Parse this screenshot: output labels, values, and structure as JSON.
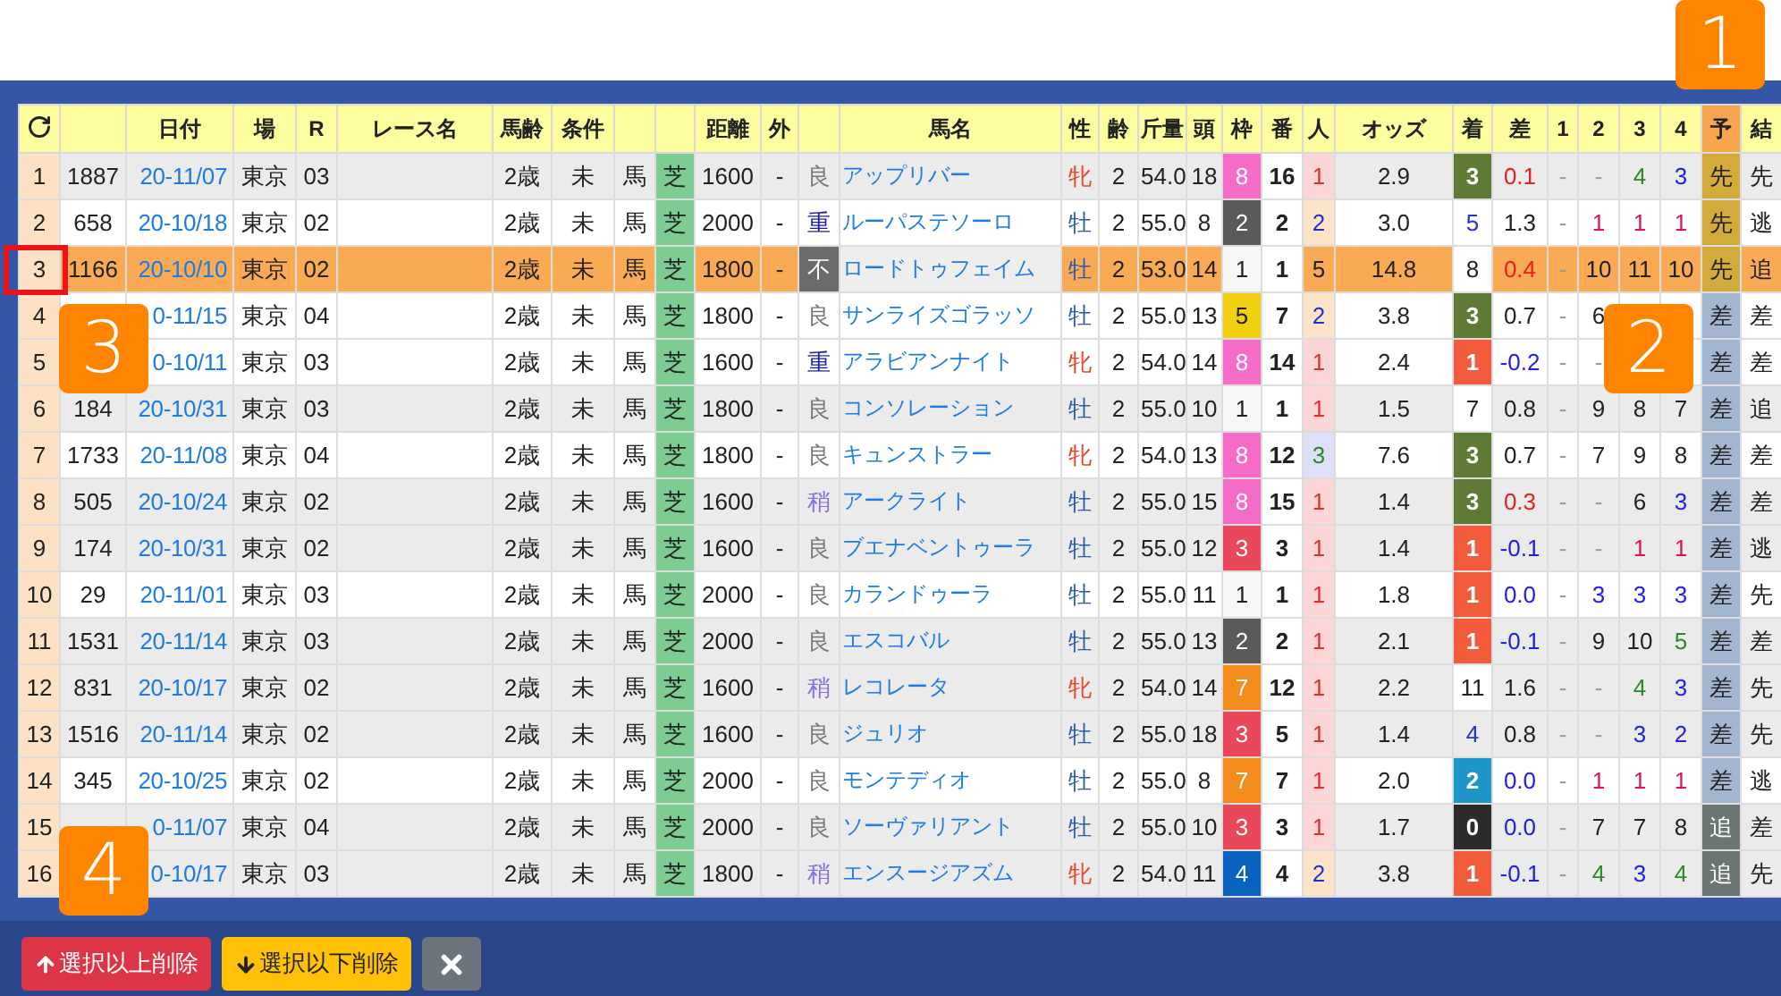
{
  "table": {
    "columns": [
      {
        "kind": "refresh"
      },
      {},
      {
        "label": "日付"
      },
      {
        "label": "場"
      },
      {
        "label": "R"
      },
      {
        "label": "レース名"
      },
      {
        "label": "馬齢"
      },
      {
        "label": "条件"
      },
      {},
      {},
      {
        "label": "距離"
      },
      {
        "label": "外"
      },
      {},
      {
        "label": "馬名"
      },
      {
        "label": "性"
      },
      {
        "label": "齢"
      },
      {
        "label": "斤量"
      },
      {
        "label": "頭"
      },
      {
        "label": "枠"
      },
      {
        "label": "番"
      },
      {
        "label": "人"
      },
      {
        "label": "オッズ"
      },
      {
        "label": "着"
      },
      {
        "label": "差"
      },
      {
        "label": "1"
      },
      {
        "label": "2"
      },
      {
        "label": "3"
      },
      {
        "label": "4"
      },
      {
        "label": "予",
        "color": "#f7a54f"
      },
      {
        "label": "結"
      }
    ],
    "rows": [
      {
        "selected": false,
        "shaded": true,
        "cells": [
          "1",
          "1887",
          "20-11/07",
          "東京",
          "03",
          null,
          "2歳",
          "未",
          "馬",
          "芝",
          "1600",
          "-",
          {
            "text": "良",
            "color": "#777777"
          },
          "アップリバー",
          {
            "text": "牝",
            "color": "#e8452c"
          },
          "2",
          "54.0",
          "18",
          {
            "kind": "fill",
            "text": "8",
            "color": "#f56cc8"
          },
          "16",
          {
            "kind": "fill",
            "text": "1",
            "color": "#fcd6d6"
          },
          "2.9",
          {
            "kind": "fill",
            "text": "3",
            "color": "#5e7b36"
          },
          {
            "text": "0.1",
            "color": "#e62020"
          },
          {
            "text": "-",
            "color": "#999999"
          },
          {
            "text": "-",
            "color": "#999999"
          },
          {
            "text": "4",
            "color": "#2a8a2a"
          },
          {
            "text": "3",
            "color": "#2222dd"
          },
          {
            "kind": "fill",
            "text": "先",
            "color": "#d3aa3c"
          },
          "先"
        ]
      },
      {
        "selected": false,
        "shaded": false,
        "cells": [
          "2",
          "658",
          "20-10/18",
          "東京",
          "02",
          null,
          "2歳",
          "未",
          "馬",
          "芝",
          "2000",
          "-",
          {
            "text": "重",
            "color": "#1a1aa0"
          },
          "ルーパステソーロ",
          {
            "text": "牡",
            "color": "#2a5caa"
          },
          "2",
          "55.0",
          "8",
          {
            "kind": "fill",
            "text": "2",
            "color": "#5a5a5a"
          },
          "2",
          {
            "kind": "fill",
            "text": "2",
            "color": "#fde4c8"
          },
          "3.0",
          {
            "text": "5",
            "color": "#2233cc"
          },
          "1.3",
          {
            "text": "-",
            "color": "#999999"
          },
          {
            "text": "1",
            "color": "#e0105a"
          },
          {
            "text": "1",
            "color": "#e0105a"
          },
          {
            "text": "1",
            "color": "#e0105a"
          },
          {
            "kind": "fill",
            "text": "先",
            "color": "#d3aa3c"
          },
          "逃"
        ]
      },
      {
        "selected": true,
        "cells": [
          "3",
          "1166",
          "20-10/10",
          "東京",
          "02",
          null,
          "2歳",
          "未",
          "馬",
          "芝",
          "1800",
          "-",
          {
            "kind": "fill",
            "text": "不",
            "color": "#6b6b6b"
          },
          {
            "kind": "fill",
            "text": "ロードトゥフェイム",
            "color": "#eeeeee"
          },
          {
            "text": "牡",
            "color": "#2a5caa"
          },
          "2",
          "53.0",
          "14",
          {
            "kind": "fill",
            "text": "1",
            "color": "#f7f7f7"
          },
          "1",
          "5",
          "14.8",
          {
            "kind": "fill",
            "text": "8",
            "color": "#ffffff"
          },
          {
            "text": "0.4",
            "color": "#e62020"
          },
          {
            "text": "-",
            "color": "#999999"
          },
          "10",
          "11",
          "10",
          {
            "kind": "fill",
            "text": "先",
            "color": "#d3aa3c"
          },
          "追"
        ]
      },
      {
        "selected": false,
        "shaded": false,
        "cells": [
          "4",
          null,
          "0-11/15",
          "東京",
          "04",
          null,
          "2歳",
          "未",
          "馬",
          "芝",
          "1800",
          "-",
          {
            "text": "良",
            "color": "#777777"
          },
          "サンライズゴラッソ",
          {
            "text": "牡",
            "color": "#2a5caa"
          },
          "2",
          "55.0",
          "13",
          {
            "kind": "fill",
            "text": "5",
            "color": "#f0d010"
          },
          "7",
          {
            "kind": "fill",
            "text": "2",
            "color": "#fde4c8"
          },
          "3.8",
          {
            "kind": "fill",
            "text": "3",
            "color": "#5e7b36"
          },
          "0.7",
          {
            "text": "-",
            "color": "#999999"
          },
          "6",
          null,
          null,
          {
            "kind": "fill",
            "text": "差",
            "color": "#a2b7cf"
          },
          "差"
        ]
      },
      {
        "selected": false,
        "shaded": false,
        "cells": [
          "5",
          null,
          "0-10/11",
          "東京",
          "03",
          null,
          "2歳",
          "未",
          "馬",
          "芝",
          "1600",
          "-",
          {
            "text": "重",
            "color": "#1a1aa0"
          },
          "アラビアンナイト",
          {
            "text": "牝",
            "color": "#e8452c"
          },
          "2",
          "54.0",
          "14",
          {
            "kind": "fill",
            "text": "8",
            "color": "#f56cc8"
          },
          "14",
          {
            "kind": "fill",
            "text": "1",
            "color": "#fcd6d6"
          },
          "2.4",
          {
            "kind": "fill",
            "text": "1",
            "color": "#f25c3c"
          },
          {
            "text": "-0.2",
            "color": "#2020e0"
          },
          {
            "text": "-",
            "color": "#999999"
          },
          {
            "text": "-",
            "color": "#999999"
          },
          null,
          null,
          {
            "kind": "fill",
            "text": "差",
            "color": "#a2b7cf"
          },
          "差"
        ]
      },
      {
        "selected": false,
        "shaded": true,
        "cells": [
          "6",
          "184",
          "20-10/31",
          "東京",
          "03",
          null,
          "2歳",
          "未",
          "馬",
          "芝",
          "1800",
          "-",
          {
            "text": "良",
            "color": "#777777"
          },
          "コンソレーション",
          {
            "text": "牡",
            "color": "#2a5caa"
          },
          "2",
          "55.0",
          "10",
          {
            "kind": "fill",
            "text": "1",
            "color": "#f7f7f7"
          },
          "1",
          {
            "kind": "fill",
            "text": "1",
            "color": "#fcd6d6"
          },
          "1.5",
          {
            "kind": "fill",
            "text": "7",
            "color": "#ffffff"
          },
          "0.8",
          {
            "text": "-",
            "color": "#999999"
          },
          "9",
          "8",
          "7",
          {
            "kind": "fill",
            "text": "差",
            "color": "#a2b7cf"
          },
          "追"
        ]
      },
      {
        "selected": false,
        "shaded": false,
        "cells": [
          "7",
          "1733",
          "20-11/08",
          "東京",
          "04",
          null,
          "2歳",
          "未",
          "馬",
          "芝",
          "1800",
          "-",
          {
            "text": "良",
            "color": "#777777"
          },
          "キュンストラー",
          {
            "text": "牝",
            "color": "#e8452c"
          },
          "2",
          "54.0",
          "13",
          {
            "kind": "fill",
            "text": "8",
            "color": "#f56cc8"
          },
          "12",
          {
            "kind": "fill",
            "text": "3",
            "color": "#dde0f8"
          },
          "7.6",
          {
            "kind": "fill",
            "text": "3",
            "color": "#5e7b36"
          },
          "0.7",
          {
            "text": "-",
            "color": "#999999"
          },
          "7",
          "9",
          "8",
          {
            "kind": "fill",
            "text": "差",
            "color": "#a2b7cf"
          },
          "差"
        ]
      },
      {
        "selected": false,
        "shaded": true,
        "cells": [
          "8",
          "505",
          "20-10/24",
          "東京",
          "02",
          null,
          "2歳",
          "未",
          "馬",
          "芝",
          "1600",
          "-",
          {
            "text": "稍",
            "color": "#8a6ee0"
          },
          "アークライト",
          {
            "text": "牡",
            "color": "#2a5caa"
          },
          "2",
          "55.0",
          "15",
          {
            "kind": "fill",
            "text": "8",
            "color": "#f56cc8"
          },
          "15",
          {
            "kind": "fill",
            "text": "1",
            "color": "#fcd6d6"
          },
          "1.4",
          {
            "kind": "fill",
            "text": "3",
            "color": "#5e7b36"
          },
          {
            "text": "0.3",
            "color": "#e62020"
          },
          {
            "text": "-",
            "color": "#999999"
          },
          {
            "text": "-",
            "color": "#999999"
          },
          "6",
          {
            "text": "3",
            "color": "#2222dd"
          },
          {
            "kind": "fill",
            "text": "差",
            "color": "#a2b7cf"
          },
          "差"
        ]
      },
      {
        "selected": false,
        "shaded": true,
        "cells": [
          "9",
          "174",
          "20-10/31",
          "東京",
          "02",
          null,
          "2歳",
          "未",
          "馬",
          "芝",
          "1600",
          "-",
          {
            "text": "良",
            "color": "#777777"
          },
          "ブエナベントゥーラ",
          {
            "text": "牡",
            "color": "#2a5caa"
          },
          "2",
          "55.0",
          "12",
          {
            "kind": "fill",
            "text": "3",
            "color": "#e9475a"
          },
          "3",
          {
            "kind": "fill",
            "text": "1",
            "color": "#fcd6d6"
          },
          "1.4",
          {
            "kind": "fill",
            "text": "1",
            "color": "#f25c3c"
          },
          {
            "text": "-0.1",
            "color": "#2020e0"
          },
          {
            "text": "-",
            "color": "#999999"
          },
          {
            "text": "-",
            "color": "#999999"
          },
          {
            "text": "1",
            "color": "#e0105a"
          },
          {
            "text": "1",
            "color": "#e0105a"
          },
          {
            "kind": "fill",
            "text": "差",
            "color": "#a2b7cf"
          },
          "逃"
        ]
      },
      {
        "selected": false,
        "shaded": false,
        "cells": [
          "10",
          "29",
          "20-11/01",
          "東京",
          "03",
          null,
          "2歳",
          "未",
          "馬",
          "芝",
          "2000",
          "-",
          {
            "text": "良",
            "color": "#777777"
          },
          "カランドゥーラ",
          {
            "text": "牡",
            "color": "#2a5caa"
          },
          "2",
          "55.0",
          "11",
          {
            "kind": "fill",
            "text": "1",
            "color": "#f7f7f7"
          },
          "1",
          {
            "kind": "fill",
            "text": "1",
            "color": "#fcd6d6"
          },
          "1.8",
          {
            "kind": "fill",
            "text": "1",
            "color": "#f25c3c"
          },
          {
            "text": "0.0",
            "color": "#2020e0"
          },
          {
            "text": "-",
            "color": "#999999"
          },
          {
            "text": "3",
            "color": "#2222dd"
          },
          {
            "text": "3",
            "color": "#2222dd"
          },
          {
            "text": "3",
            "color": "#2222dd"
          },
          {
            "kind": "fill",
            "text": "差",
            "color": "#a2b7cf"
          },
          "先"
        ]
      },
      {
        "selected": false,
        "shaded": true,
        "cells": [
          "11",
          "1531",
          "20-11/14",
          "東京",
          "03",
          null,
          "2歳",
          "未",
          "馬",
          "芝",
          "2000",
          "-",
          {
            "text": "良",
            "color": "#777777"
          },
          "エスコバル",
          {
            "text": "牡",
            "color": "#2a5caa"
          },
          "2",
          "55.0",
          "13",
          {
            "kind": "fill",
            "text": "2",
            "color": "#5a5a5a"
          },
          "2",
          {
            "kind": "fill",
            "text": "1",
            "color": "#fcd6d6"
          },
          "2.1",
          {
            "kind": "fill",
            "text": "1",
            "color": "#f25c3c"
          },
          {
            "text": "-0.1",
            "color": "#2020e0"
          },
          {
            "text": "-",
            "color": "#999999"
          },
          "9",
          "10",
          {
            "text": "5",
            "color": "#2a8a2a"
          },
          {
            "kind": "fill",
            "text": "差",
            "color": "#a2b7cf"
          },
          "差"
        ]
      },
      {
        "selected": false,
        "shaded": true,
        "cells": [
          "12",
          "831",
          "20-10/17",
          "東京",
          "02",
          null,
          "2歳",
          "未",
          "馬",
          "芝",
          "1600",
          "-",
          {
            "text": "稍",
            "color": "#8a6ee0"
          },
          "レコレータ",
          {
            "text": "牝",
            "color": "#e8452c"
          },
          "2",
          "54.0",
          "14",
          {
            "kind": "fill",
            "text": "7",
            "color": "#f58c1e"
          },
          "12",
          {
            "kind": "fill",
            "text": "1",
            "color": "#fcd6d6"
          },
          "2.2",
          {
            "kind": "fill",
            "text": "11",
            "color": "#ffffff"
          },
          "1.6",
          {
            "text": "-",
            "color": "#999999"
          },
          {
            "text": "-",
            "color": "#999999"
          },
          {
            "text": "4",
            "color": "#2a8a2a"
          },
          {
            "text": "3",
            "color": "#2222dd"
          },
          {
            "kind": "fill",
            "text": "差",
            "color": "#a2b7cf"
          },
          "先"
        ]
      },
      {
        "selected": false,
        "shaded": true,
        "cells": [
          "13",
          "1516",
          "20-11/14",
          "東京",
          "02",
          null,
          "2歳",
          "未",
          "馬",
          "芝",
          "1600",
          "-",
          {
            "text": "良",
            "color": "#777777"
          },
          "ジュリオ",
          {
            "text": "牡",
            "color": "#2a5caa"
          },
          "2",
          "55.0",
          "18",
          {
            "kind": "fill",
            "text": "3",
            "color": "#e9475a"
          },
          "5",
          {
            "kind": "fill",
            "text": "1",
            "color": "#fcd6d6"
          },
          "1.4",
          {
            "text": "4",
            "color": "#2233cc"
          },
          "0.8",
          {
            "text": "-",
            "color": "#999999"
          },
          {
            "text": "-",
            "color": "#999999"
          },
          {
            "text": "3",
            "color": "#2222dd"
          },
          {
            "text": "2",
            "color": "#2222dd"
          },
          {
            "kind": "fill",
            "text": "差",
            "color": "#a2b7cf"
          },
          "先"
        ]
      },
      {
        "selected": false,
        "shaded": false,
        "cells": [
          "14",
          "345",
          "20-10/25",
          "東京",
          "02",
          null,
          "2歳",
          "未",
          "馬",
          "芝",
          "2000",
          "-",
          {
            "text": "良",
            "color": "#777777"
          },
          "モンテディオ",
          {
            "text": "牡",
            "color": "#2a5caa"
          },
          "2",
          "55.0",
          "8",
          {
            "kind": "fill",
            "text": "7",
            "color": "#f58c1e"
          },
          "7",
          {
            "kind": "fill",
            "text": "1",
            "color": "#fcd6d6"
          },
          "2.0",
          {
            "kind": "fill",
            "text": "2",
            "color": "#1f96c8"
          },
          {
            "text": "0.0",
            "color": "#2020e0"
          },
          {
            "text": "-",
            "color": "#999999"
          },
          {
            "text": "1",
            "color": "#e0105a"
          },
          {
            "text": "1",
            "color": "#e0105a"
          },
          {
            "text": "1",
            "color": "#e0105a"
          },
          {
            "kind": "fill",
            "text": "差",
            "color": "#a2b7cf"
          },
          "逃"
        ]
      },
      {
        "selected": false,
        "shaded": true,
        "cells": [
          "15",
          null,
          "0-11/07",
          "東京",
          "04",
          null,
          "2歳",
          "未",
          "馬",
          "芝",
          "2000",
          "-",
          {
            "text": "良",
            "color": "#777777"
          },
          "ソーヴァリアント",
          {
            "text": "牡",
            "color": "#2a5caa"
          },
          "2",
          "55.0",
          "10",
          {
            "kind": "fill",
            "text": "3",
            "color": "#e9475a"
          },
          "3",
          {
            "kind": "fill",
            "text": "1",
            "color": "#fcd6d6"
          },
          "1.7",
          {
            "kind": "fill",
            "text": "0",
            "color": "#2b2b2b"
          },
          {
            "text": "0.0",
            "color": "#2020e0"
          },
          {
            "text": "-",
            "color": "#999999"
          },
          "7",
          "7",
          "8",
          {
            "kind": "fill",
            "text": "追",
            "color": "#6b7673"
          },
          "差"
        ]
      },
      {
        "selected": false,
        "shaded": true,
        "cells": [
          "16",
          null,
          "0-10/17",
          "東京",
          "03",
          null,
          "2歳",
          "未",
          "馬",
          "芝",
          "1800",
          "-",
          {
            "text": "稍",
            "color": "#8a6ee0"
          },
          "エンスージアズム",
          {
            "text": "牝",
            "color": "#e8452c"
          },
          "2",
          "54.0",
          "11",
          {
            "kind": "fill",
            "text": "4",
            "color": "#0a62c0"
          },
          "4",
          {
            "kind": "fill",
            "text": "2",
            "color": "#fde4c8"
          },
          "3.8",
          {
            "kind": "fill",
            "text": "1",
            "color": "#f25c3c"
          },
          {
            "text": "-0.1",
            "color": "#2020e0"
          },
          {
            "text": "-",
            "color": "#999999"
          },
          {
            "text": "4",
            "color": "#2a8a2a"
          },
          {
            "text": "3",
            "color": "#2222dd"
          },
          {
            "text": "4",
            "color": "#2a8a2a"
          },
          {
            "kind": "fill",
            "text": "追",
            "color": "#6b7673"
          },
          "先"
        ]
      }
    ]
  },
  "buttons": [
    {
      "kind": "up",
      "label": "選択以上削除"
    },
    {
      "kind": "down",
      "label": "選択以下削除"
    },
    {
      "kind": "close"
    }
  ],
  "callouts": [
    {
      "text": "1"
    },
    {
      "text": "2"
    },
    {
      "text": "3"
    },
    {
      "text": "4"
    }
  ]
}
